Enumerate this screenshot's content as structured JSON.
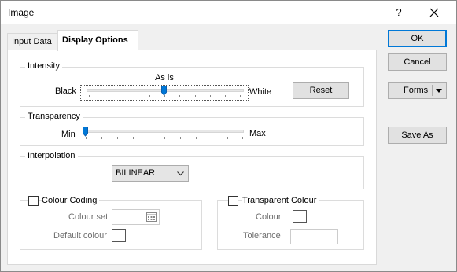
{
  "window": {
    "title": "Image",
    "help_label": "?"
  },
  "tabs": [
    {
      "label": "Input Data",
      "active": false
    },
    {
      "label": "Display Options",
      "active": true
    }
  ],
  "intensity": {
    "group_label": "Intensity",
    "left_label": "Black",
    "right_label": "White",
    "value_label": "As is",
    "slider_value": 0.5,
    "reset_label": "Reset"
  },
  "transparency": {
    "group_label": "Transparency",
    "min_label": "Min",
    "max_label": "Max",
    "slider_value": 0.0
  },
  "interpolation": {
    "group_label": "Interpolation",
    "selected": "BILINEAR"
  },
  "colour_coding": {
    "label": "Colour Coding",
    "checked": false,
    "colour_set_label": "Colour set",
    "colour_set_value": "",
    "default_colour_label": "Default colour"
  },
  "transparent_colour": {
    "label": "Transparent Colour",
    "checked": false,
    "colour_label": "Colour",
    "tolerance_label": "Tolerance",
    "tolerance_value": ""
  },
  "buttons": {
    "ok": "OK",
    "cancel": "Cancel",
    "forms": "Forms",
    "save_as": "Save As"
  },
  "colors": {
    "accent": "#0078d7",
    "button_bg": "#e1e1e1",
    "window_bg": "#f0f0f0"
  },
  "icons": {
    "close": "close-icon",
    "dropdown": "chevron-down-icon",
    "slider_thumb": "slider-thumb-icon",
    "calendar": "calendar-icon"
  }
}
